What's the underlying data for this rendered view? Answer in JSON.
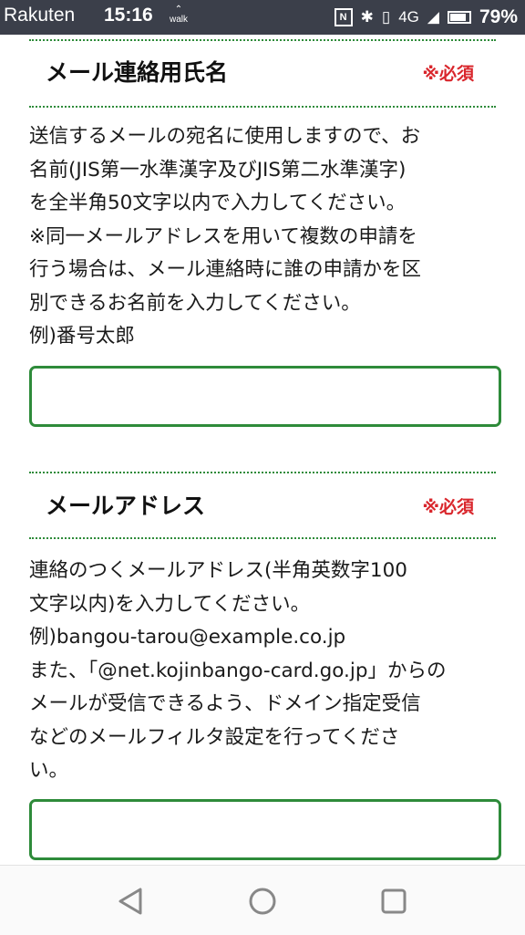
{
  "status_bar": {
    "carrier": "Rakuten",
    "time": "15:16",
    "activity": "walk",
    "network": "4G",
    "battery": "79%"
  },
  "sections": [
    {
      "title": "メール連絡用氏名",
      "required_label": "※必須",
      "description": [
        "送信するメールの宛名に使用しますので、お",
        "名前(JIS第一水準漢字及びJIS第二水準漢字)",
        "を全半角50文字以内で入力してください。",
        "※同一メールアドレスを用いて複数の申請を",
        "行う場合は、メール連絡時に誰の申請かを区",
        "別できるお名前を入力してください。",
        "例)番号太郎"
      ],
      "input_value": ""
    },
    {
      "title": "メールアドレス",
      "required_label": "※必須",
      "description": [
        "連絡のつくメールアドレス(半角英数字100",
        "文字以内)を入力してください。",
        "例)bangou-tarou@example.co.jp",
        "また、「@net.kojinbango-card.go.jp」からの",
        "メールが受信できるよう、ドメイン指定受信",
        "などのメールフィルタ設定を行ってくださ",
        "い。"
      ],
      "input_value": ""
    }
  ],
  "nav_bar": {
    "back_icon": "back-triangle-icon",
    "home_icon": "home-circle-icon",
    "recents_icon": "recents-square-icon"
  },
  "colors": {
    "accent_green": "#2e8b3a",
    "required_red": "#d9262c",
    "status_bar_bg": "#3b3f4a"
  }
}
